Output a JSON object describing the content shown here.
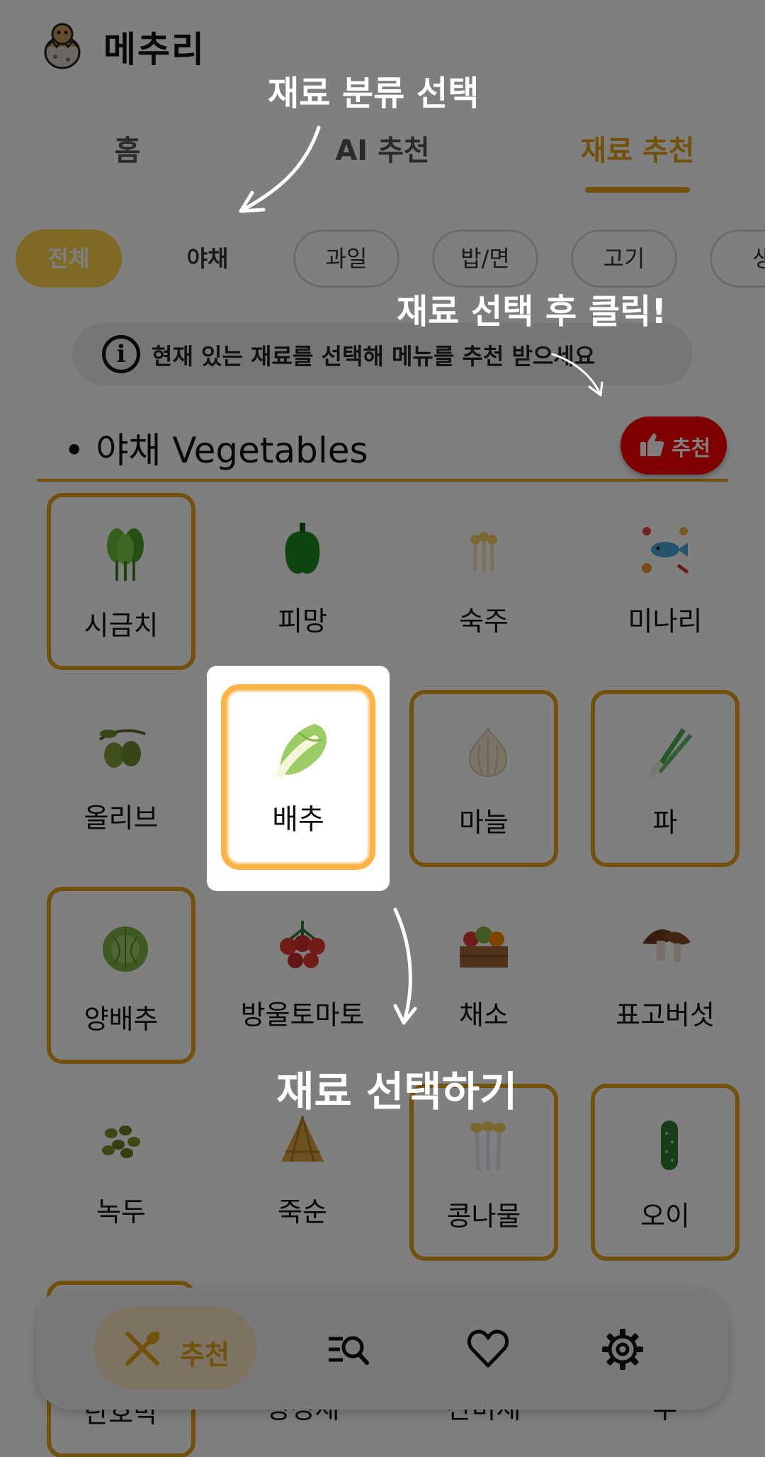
{
  "app": {
    "title": "메추리"
  },
  "tabs": [
    {
      "label": "홈",
      "active": false
    },
    {
      "label": "AI 추천",
      "active": false
    },
    {
      "label": "재료 추천",
      "active": true
    }
  ],
  "categories": [
    {
      "label": "전체",
      "state": "active"
    },
    {
      "label": "야채",
      "state": "selected"
    },
    {
      "label": "과일",
      "state": "default"
    },
    {
      "label": "밥/면",
      "state": "default"
    },
    {
      "label": "고기",
      "state": "default"
    },
    {
      "label": "생",
      "state": "default"
    }
  ],
  "info": {
    "text": "현재 있는 재료를 선택해 메뉴를 추천 받으세요",
    "icon": "info-icon"
  },
  "section": {
    "title": "• 야채 Vegetables"
  },
  "recommend_button": {
    "label": "추천",
    "icon": "thumbs-up-icon",
    "color": "#ff0000"
  },
  "ingredients": [
    {
      "name": "시금치",
      "selected": true,
      "icon": "spinach-icon"
    },
    {
      "name": "피망",
      "selected": false,
      "icon": "bell-pepper-icon"
    },
    {
      "name": "숙주",
      "selected": false,
      "icon": "bean-sprout-icon"
    },
    {
      "name": "미나리",
      "selected": false,
      "icon": "food-mix-icon"
    },
    {
      "name": "올리브",
      "selected": false,
      "icon": "olive-icon"
    },
    {
      "name": "배추",
      "selected": true,
      "icon": "napa-cabbage-icon",
      "highlighted": true
    },
    {
      "name": "마늘",
      "selected": true,
      "icon": "garlic-icon"
    },
    {
      "name": "파",
      "selected": true,
      "icon": "green-onion-icon"
    },
    {
      "name": "양배추",
      "selected": true,
      "icon": "cabbage-icon"
    },
    {
      "name": "방울토마토",
      "selected": false,
      "icon": "cherry-tomato-icon"
    },
    {
      "name": "채소",
      "selected": false,
      "icon": "vegetable-crate-icon"
    },
    {
      "name": "표고버섯",
      "selected": false,
      "icon": "shiitake-icon"
    },
    {
      "name": "녹두",
      "selected": false,
      "icon": "mung-bean-icon"
    },
    {
      "name": "죽순",
      "selected": false,
      "icon": "bamboo-shoot-icon"
    },
    {
      "name": "콩나물",
      "selected": true,
      "icon": "soybean-sprout-icon"
    },
    {
      "name": "오이",
      "selected": true,
      "icon": "cucumber-icon"
    },
    {
      "name": "단호박",
      "selected": true,
      "icon": "pumpkin-icon"
    },
    {
      "name": "청경채",
      "selected": false,
      "icon": "bok-choy-icon"
    },
    {
      "name": "산미채",
      "selected": false,
      "icon": "greens-icon"
    },
    {
      "name": "무",
      "selected": false,
      "icon": "radish-icon"
    }
  ],
  "annotations": {
    "category": "재료 분류 선택",
    "click": "재료 선택 후 클릭!",
    "select": "재료 선택하기"
  },
  "bottom_nav": {
    "recommend_label": "추천",
    "items": [
      "spoon-fork-icon",
      "search-list-icon",
      "heart-icon",
      "gear-icon"
    ]
  },
  "colors": {
    "accent": "#e5a21a",
    "chip_active": "#ffd54a",
    "highlight_border": "#ffb347"
  }
}
